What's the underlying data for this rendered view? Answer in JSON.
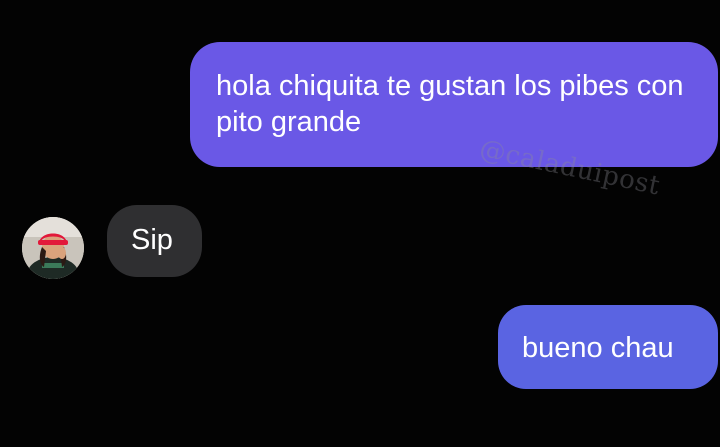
{
  "conversation": {
    "messages": [
      {
        "direction": "outgoing",
        "text": "hola chiquita te gustan los pibes con pito grande"
      },
      {
        "direction": "incoming",
        "text": "Sip"
      },
      {
        "direction": "outgoing",
        "text": "bueno chau"
      }
    ],
    "contact": {
      "avatar_icon": "profile-photo"
    }
  },
  "watermark": "@caladuipost",
  "colors": {
    "background": "#030303",
    "outgoing_bubble": "#6a58e6",
    "outgoing_bubble_2": "#5a64e2",
    "incoming_bubble": "#2f2f31"
  }
}
